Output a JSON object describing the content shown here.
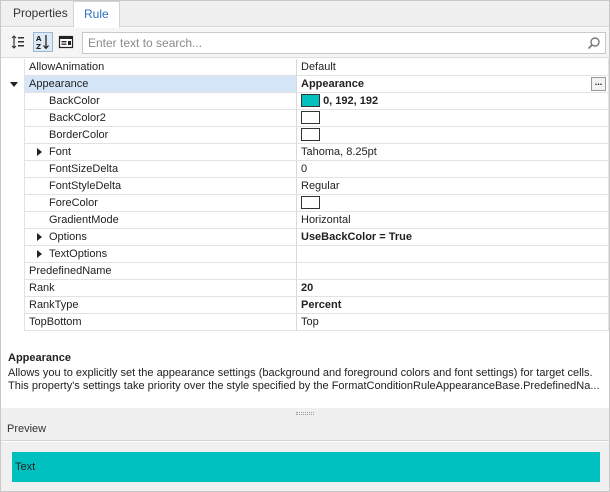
{
  "tabs": [
    {
      "label": "Properties",
      "active": false
    },
    {
      "label": "Rule",
      "active": true
    }
  ],
  "toolbar": {
    "buttons": [
      {
        "icon": "categorized-icon",
        "active": false
      },
      {
        "icon": "sort-alphabetical-icon",
        "active": true
      },
      {
        "icon": "property-pages-icon",
        "active": false
      }
    ],
    "search_placeholder": "Enter text to search..."
  },
  "grid": {
    "rows": [
      {
        "name": "AllowAnimation",
        "value": "Default"
      },
      {
        "name": "Appearance",
        "value": "Appearance"
      },
      {
        "name": "BackColor",
        "value": "0, 192, 192"
      },
      {
        "name": "BackColor2",
        "value": ""
      },
      {
        "name": "BorderColor",
        "value": ""
      },
      {
        "name": "Font",
        "value": "Tahoma, 8.25pt"
      },
      {
        "name": "FontSizeDelta",
        "value": "0"
      },
      {
        "name": "FontStyleDelta",
        "value": "Regular"
      },
      {
        "name": "ForeColor",
        "value": ""
      },
      {
        "name": "GradientMode",
        "value": "Horizontal"
      },
      {
        "name": "Options",
        "value": "UseBackColor = True"
      },
      {
        "name": "TextOptions",
        "value": ""
      },
      {
        "name": "PredefinedName",
        "value": ""
      },
      {
        "name": "Rank",
        "value": "20"
      },
      {
        "name": "RankType",
        "value": "Percent"
      },
      {
        "name": "TopBottom",
        "value": "Top"
      }
    ],
    "ellipsis_label": "..."
  },
  "colors": {
    "backcolor": "#00c0c0",
    "white": "#ffffff"
  },
  "description": {
    "title": "Appearance",
    "line1": "Allows you to explicitly set the appearance settings (background and foreground colors and font settings) for target cells.",
    "line2": "This property's settings take priority over the style specified by the FormatConditionRuleAppearanceBase.PredefinedNa..."
  },
  "preview": {
    "header": "Preview",
    "text": "Text"
  }
}
